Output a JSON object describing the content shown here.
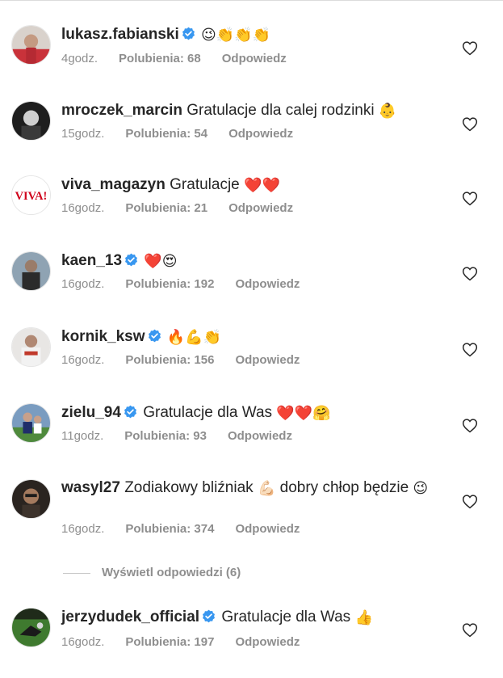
{
  "comments": [
    {
      "username": "lukasz.fabianski",
      "verified": true,
      "text": "",
      "emoji": "😉👏👏👏",
      "time": "4godz.",
      "likes": "Polubienia: 68",
      "reply": "Odpowiedz",
      "avatar_icon": "profile-photo"
    },
    {
      "username": "mroczek_marcin",
      "verified": false,
      "text": "Gratulacje dla calej rodzinki",
      "emoji": "👶",
      "time": "15godz.",
      "likes": "Polubienia: 54",
      "reply": "Odpowiedz",
      "avatar_icon": "profile-photo"
    },
    {
      "username": "viva_magazyn",
      "verified": false,
      "text": "Gratulacje",
      "emoji": "❤️❤️",
      "time": "16godz.",
      "likes": "Polubienia: 21",
      "reply": "Odpowiedz",
      "avatar_icon": "viva-logo",
      "avatar_text": "VIVA!"
    },
    {
      "username": "kaen_13",
      "verified": true,
      "text": "",
      "emoji": "❤️😍",
      "time": "16godz.",
      "likes": "Polubienia: 192",
      "reply": "Odpowiedz",
      "avatar_icon": "profile-photo"
    },
    {
      "username": "kornik_ksw",
      "verified": true,
      "text": "",
      "emoji": "🔥💪👏",
      "time": "16godz.",
      "likes": "Polubienia: 156",
      "reply": "Odpowiedz",
      "avatar_icon": "profile-photo"
    },
    {
      "username": "zielu_94",
      "verified": true,
      "text": "Gratulacje dla Was",
      "emoji": "❤️❤️🤗",
      "time": "11godz.",
      "likes": "Polubienia: 93",
      "reply": "Odpowiedz",
      "avatar_icon": "profile-photo"
    },
    {
      "username": "wasyl27",
      "verified": false,
      "text": "Zodiakowy bliźniak",
      "emoji": "💪🏻",
      "text2": "dobry chłop będzie",
      "emoji2": "😉",
      "time": "16godz.",
      "likes": "Polubienia: 374",
      "reply": "Odpowiedz",
      "avatar_icon": "profile-photo"
    },
    {
      "username": "jerzydudek_official",
      "verified": true,
      "text": "Gratulacje dla Was",
      "emoji": "👍",
      "time": "16godz.",
      "likes": "Polubienia: 197",
      "reply": "Odpowiedz",
      "avatar_icon": "profile-photo"
    }
  ],
  "view_replies": "Wyświetl odpowiedzi (6)",
  "colors": {
    "verified": "#3897f0",
    "muted": "#8e8e8e",
    "text": "#262626",
    "viva": "#d0021b"
  }
}
